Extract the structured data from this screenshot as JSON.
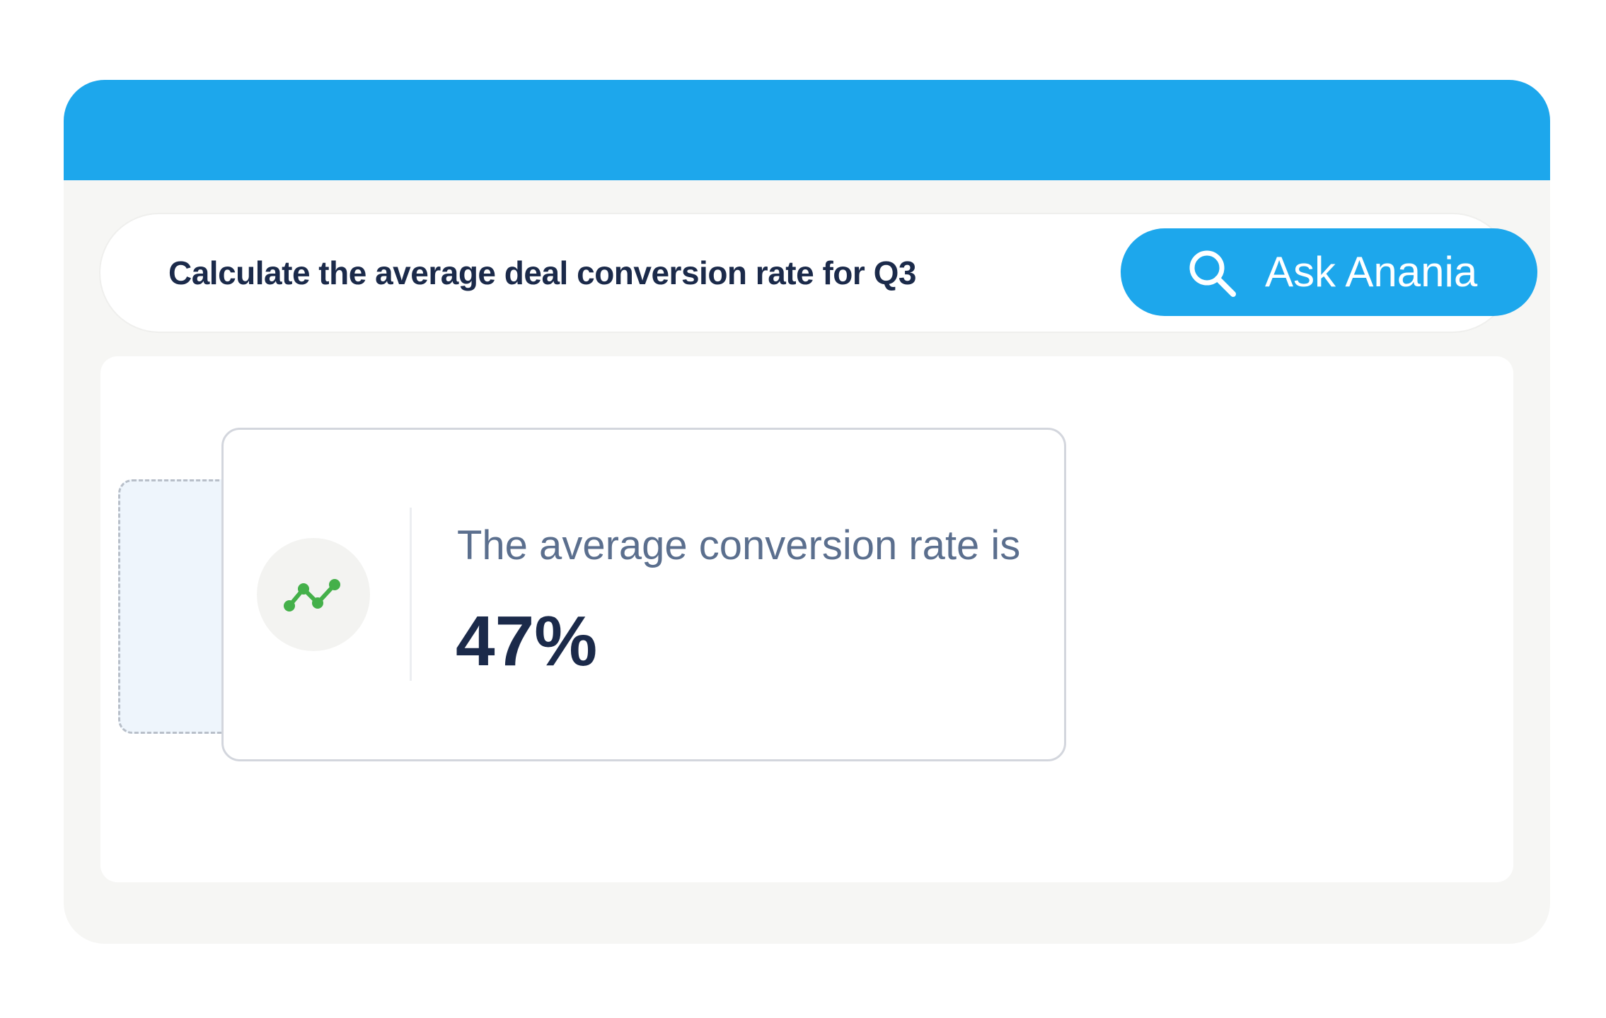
{
  "app": {
    "accent_color": "#1da7ec",
    "text_color": "#1b2a4a"
  },
  "search": {
    "query": "Calculate the average deal conversion rate for Q3",
    "button_label": "Ask Anania",
    "button_icon": "search-icon"
  },
  "result": {
    "icon": "trend-line-icon",
    "icon_color": "#44b04a",
    "label": "The average conversion rate is",
    "value": "47%"
  }
}
